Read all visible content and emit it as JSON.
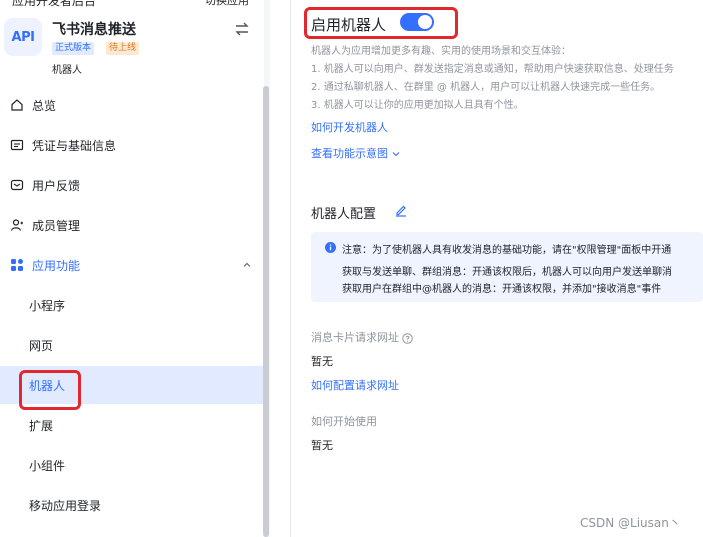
{
  "sidebar": {
    "top_cut_left": "应用开发者后台",
    "top_cut_right": "切换应用",
    "app": {
      "icon_text": "API",
      "name": "飞书消息推送",
      "badge_prod": "正式版本",
      "badge_pending": "待上线",
      "subtitle": "机器人"
    },
    "nav": [
      {
        "label": "总览",
        "icon": "home-icon"
      },
      {
        "label": "凭证与基础信息",
        "icon": "credential-icon"
      },
      {
        "label": "用户反馈",
        "icon": "feedback-icon"
      },
      {
        "label": "成员管理",
        "icon": "member-icon"
      },
      {
        "label": "应用功能",
        "icon": "apps-icon"
      }
    ],
    "sub_nav": [
      {
        "label": "小程序"
      },
      {
        "label": "网页"
      },
      {
        "label": "机器人"
      },
      {
        "label": "扩展"
      },
      {
        "label": "小组件"
      },
      {
        "label": "移动应用登录"
      }
    ]
  },
  "main": {
    "enable_title": "启用机器人",
    "toggle_on": true,
    "desc": [
      "机器人为应用增加更多有趣、实用的使用场景和交互体验：",
      "1. 机器人可以向用户、群发送指定消息或通知，帮助用户快速获取信息、处理任务",
      "2. 通过私聊机器人、在群里 @ 机器人，用户可以让机器人快速完成一些任务。",
      "3. 机器人可以让你的应用更加拟人且具有个性。"
    ],
    "link_dev": "如何开发机器人",
    "link_diagram": "查看功能示意图",
    "config_title": "机器人配置",
    "notice": [
      "注意：为了使机器人具有收发消息的基础功能，请在\"权限管理\"面板中开通",
      "获取与发送单聊、群组消息：开通该权限后，机器人可以向用户发送单聊消",
      "获取用户在群组中@机器人的消息：开通该权限，并添加\"接收消息\"事件"
    ],
    "card_url_label": "消息卡片请求网址",
    "card_url_value": "暂无",
    "card_url_link": "如何配置请求网址",
    "start_label": "如何开始使用",
    "start_value": "暂无"
  },
  "watermark": "CSDN @Liusan丶",
  "colors": {
    "accent": "#3370ff",
    "highlight": "#e0282e"
  }
}
